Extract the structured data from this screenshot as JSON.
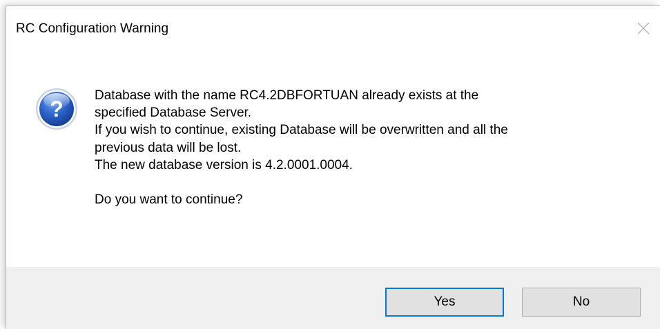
{
  "window": {
    "title": "RC Configuration Warning",
    "close_icon": "close-icon"
  },
  "message": {
    "icon": "question-icon",
    "lines": [
      "Database with the name RC4.2DBFORTUAN already exists at the",
      "specified Database Server.",
      "If you wish to continue, existing Database will be overwritten and all the",
      "previous data will be lost.",
      "The new database version is 4.2.0001.0004."
    ],
    "question": "Do you want to continue?"
  },
  "buttons": {
    "yes_label": "Yes",
    "no_label": "No"
  },
  "colors": {
    "focus_border": "#0078d7",
    "button_face": "#e1e1e1",
    "button_bar": "#f0f0f0",
    "icon_blue": "#1d55b8"
  }
}
